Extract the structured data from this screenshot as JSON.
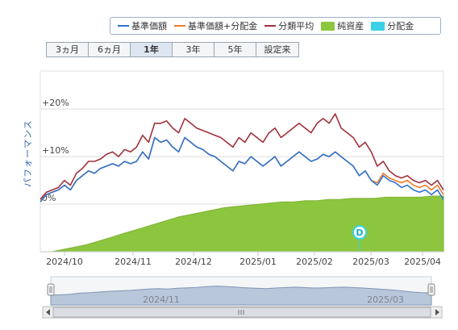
{
  "legend": {
    "items": [
      {
        "label": "基準価額",
        "color": "#2f74d0",
        "kind": "line"
      },
      {
        "label": "基準価額+分配金",
        "color": "#f07b2a",
        "kind": "line"
      },
      {
        "label": "分類平均",
        "color": "#a0323a",
        "kind": "line"
      },
      {
        "label": "純資産",
        "color": "#8cc63f",
        "kind": "area"
      },
      {
        "label": "分配金",
        "color": "#3ad1e6",
        "kind": "area"
      }
    ]
  },
  "range_buttons": [
    {
      "label": "3ヵ月",
      "active": false
    },
    {
      "label": "6ヵ月",
      "active": false
    },
    {
      "label": "1年",
      "active": true
    },
    {
      "label": "3年",
      "active": false
    },
    {
      "label": "5年",
      "active": false
    },
    {
      "label": "設定来",
      "active": false
    }
  ],
  "axis_title": "パフォーマンス",
  "dividend_marker": "D",
  "chart_data": {
    "type": "line",
    "title": "",
    "ylabel": "パフォーマンス",
    "xlabel": "",
    "ylim": [
      -10,
      28
    ],
    "ytick_labels": [
      "+20%",
      "+10%",
      "0%"
    ],
    "xtick_labels": [
      "2024/10",
      "2024/11",
      "2024/12",
      "2025/01",
      "2025/02",
      "2025/03",
      "2025/04"
    ],
    "x_start": "2024/10/01",
    "x_end": "2025/04/08",
    "series": [
      {
        "name": "基準価額",
        "color": "#2f74d0",
        "values": [
          0.5,
          2,
          2.5,
          3,
          4,
          3,
          5,
          6,
          7,
          6.5,
          7.5,
          8,
          8.5,
          8,
          9,
          8.5,
          9,
          11,
          9.5,
          14,
          13,
          13.5,
          12,
          11,
          14,
          13,
          12,
          11.5,
          10.5,
          10,
          9,
          8,
          7,
          9,
          8.5,
          10,
          9,
          8,
          9,
          10,
          8,
          9,
          10,
          11,
          10,
          9,
          9.5,
          10.5,
          10,
          11,
          10,
          9,
          8,
          6,
          7,
          5,
          4,
          6,
          5,
          4.5,
          3.5,
          4,
          3,
          2.5,
          3,
          2,
          3,
          1
        ]
      },
      {
        "name": "基準価額+分配金",
        "color": "#f07b2a",
        "values": [
          0.5,
          2,
          2.5,
          3,
          4,
          3,
          5,
          6,
          7,
          6.5,
          7.5,
          8,
          8.5,
          8,
          9,
          8.5,
          9,
          11,
          9.5,
          14,
          13,
          13.5,
          12,
          11,
          14,
          13,
          12,
          11.5,
          10.5,
          10,
          9,
          8,
          7,
          9,
          8.5,
          10,
          9,
          8,
          9,
          10,
          8,
          9,
          10,
          11,
          10,
          9,
          9.5,
          10.5,
          10,
          11,
          10,
          9,
          8,
          6,
          7,
          5,
          4.5,
          6.5,
          5.5,
          5,
          4.5,
          5,
          4,
          3.5,
          4,
          3,
          4,
          2
        ]
      },
      {
        "name": "分類平均",
        "color": "#a0323a",
        "values": [
          1,
          2.5,
          3,
          3.5,
          5,
          4,
          6.5,
          7.5,
          9,
          9,
          9.5,
          10.5,
          11,
          10,
          11.5,
          11,
          12,
          14.5,
          13,
          17,
          17,
          17.5,
          16,
          15,
          18,
          17,
          16,
          15.5,
          15,
          14.5,
          14,
          13,
          12,
          14,
          13,
          15,
          14,
          13,
          15,
          16,
          14,
          15,
          16,
          17,
          16,
          15,
          17,
          18,
          17,
          19,
          16,
          15,
          14,
          12,
          13,
          11,
          8,
          9,
          7,
          6,
          5.5,
          6,
          5,
          4.5,
          5,
          4,
          5,
          3
        ]
      }
    ],
    "net_assets": {
      "name": "純資産",
      "color": "#8cc63f",
      "shape": "rising from near zero in 2024/10 and levelling off from 2025/01"
    },
    "dividends": [
      {
        "date": "2025/03",
        "label": "D"
      }
    ],
    "grid": true,
    "legend_position": "top-right"
  },
  "navigator": {
    "tick_labels": [
      "2024/11",
      "2025/03"
    ]
  }
}
